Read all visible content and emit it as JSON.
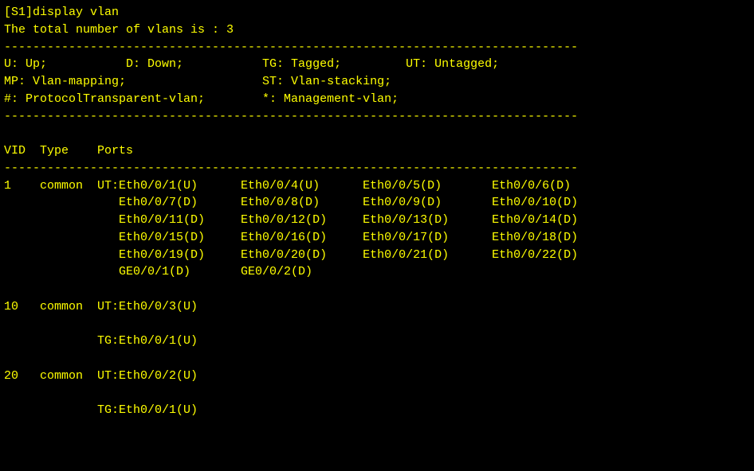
{
  "prompt": "[S1]display vlan",
  "total_line": "The total number of vlans is : 3",
  "dashes": "--------------------------------------------------------------------------------",
  "legend": {
    "l1": "U: Up;           D: Down;           TG: Tagged;         UT: Untagged;",
    "l2": "MP: Vlan-mapping;                   ST: Vlan-stacking;",
    "l3": "#: ProtocolTransparent-vlan;        *: Management-vlan;"
  },
  "header": "VID  Type    Ports",
  "vlan1": {
    "r1": "1    common  UT:Eth0/0/1(U)      Eth0/0/4(U)      Eth0/0/5(D)       Eth0/0/6(D)",
    "r2": "                Eth0/0/7(D)      Eth0/0/8(D)      Eth0/0/9(D)       Eth0/0/10(D)",
    "r3": "                Eth0/0/11(D)     Eth0/0/12(D)     Eth0/0/13(D)      Eth0/0/14(D)",
    "r4": "                Eth0/0/15(D)     Eth0/0/16(D)     Eth0/0/17(D)      Eth0/0/18(D)",
    "r5": "                Eth0/0/19(D)     Eth0/0/20(D)     Eth0/0/21(D)      Eth0/0/22(D)",
    "r6": "                GE0/0/1(D)       GE0/0/2(D)"
  },
  "vlan10": {
    "r1": "10   common  UT:Eth0/0/3(U)",
    "r2": "",
    "r3": "             TG:Eth0/0/1(U)"
  },
  "vlan20": {
    "r1": "20   common  UT:Eth0/0/2(U)",
    "r2": "",
    "r3": "             TG:Eth0/0/1(U)"
  },
  "chart_data": {
    "type": "table",
    "title": "display vlan",
    "total_vlans": 3,
    "legend": {
      "U": "Up",
      "D": "Down",
      "TG": "Tagged",
      "UT": "Untagged",
      "MP": "Vlan-mapping",
      "ST": "Vlan-stacking",
      "#": "ProtocolTransparent-vlan",
      "*": "Management-vlan"
    },
    "columns": [
      "VID",
      "Type",
      "Ports"
    ],
    "vlans": [
      {
        "vid": 1,
        "type": "common",
        "UT": [
          "Eth0/0/1(U)",
          "Eth0/0/4(U)",
          "Eth0/0/5(D)",
          "Eth0/0/6(D)",
          "Eth0/0/7(D)",
          "Eth0/0/8(D)",
          "Eth0/0/9(D)",
          "Eth0/0/10(D)",
          "Eth0/0/11(D)",
          "Eth0/0/12(D)",
          "Eth0/0/13(D)",
          "Eth0/0/14(D)",
          "Eth0/0/15(D)",
          "Eth0/0/16(D)",
          "Eth0/0/17(D)",
          "Eth0/0/18(D)",
          "Eth0/0/19(D)",
          "Eth0/0/20(D)",
          "Eth0/0/21(D)",
          "Eth0/0/22(D)",
          "GE0/0/1(D)",
          "GE0/0/2(D)"
        ],
        "TG": []
      },
      {
        "vid": 10,
        "type": "common",
        "UT": [
          "Eth0/0/3(U)"
        ],
        "TG": [
          "Eth0/0/1(U)"
        ]
      },
      {
        "vid": 20,
        "type": "common",
        "UT": [
          "Eth0/0/2(U)"
        ],
        "TG": [
          "Eth0/0/1(U)"
        ]
      }
    ]
  }
}
